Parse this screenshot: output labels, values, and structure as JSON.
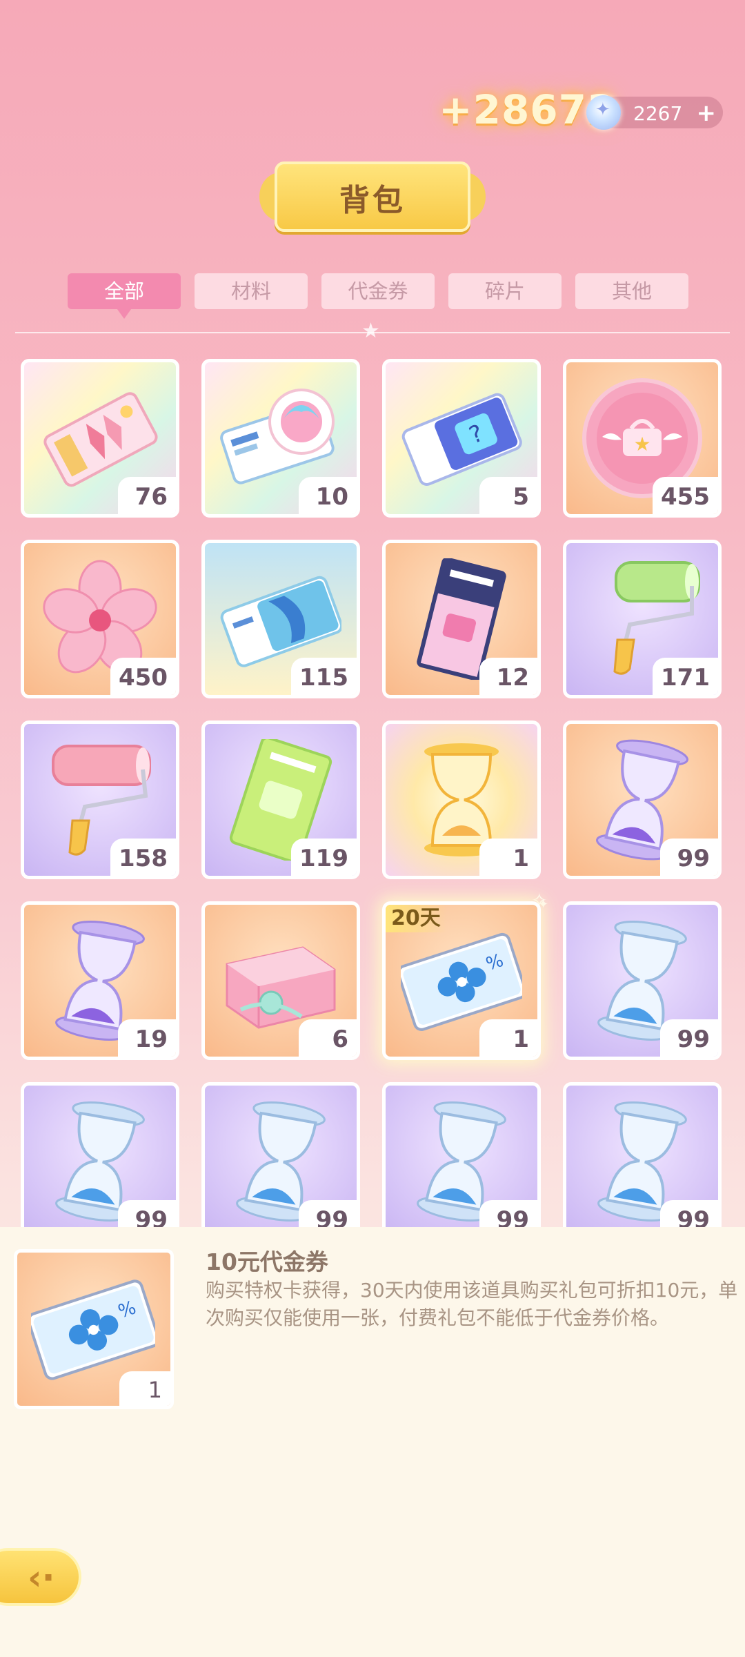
{
  "header": {
    "gain_text": "+28673",
    "currency": {
      "icon": "gem-icon",
      "amount": "2267",
      "add_label": "+"
    },
    "title": "背包"
  },
  "tabs": [
    {
      "label": "全部",
      "active": true
    },
    {
      "label": "材料",
      "active": false
    },
    {
      "label": "代金券",
      "active": false
    },
    {
      "label": "碎片",
      "active": false
    },
    {
      "label": "其他",
      "active": false
    }
  ],
  "items": [
    {
      "icon": "pink-ticket-icon",
      "count": "76",
      "bg": "rainbow"
    },
    {
      "icon": "avatar-ticket-icon",
      "count": "10",
      "bg": "rainbow"
    },
    {
      "icon": "mystery-ticket-icon",
      "count": "5",
      "bg": "rainbow"
    },
    {
      "icon": "pink-coin-icon",
      "count": "455",
      "bg": "orange"
    },
    {
      "icon": "sakura-flower-icon",
      "count": "450",
      "bg": "orange"
    },
    {
      "icon": "blue-ticket-icon",
      "count": "115",
      "bg": "blue"
    },
    {
      "icon": "sakura-ticket-icon",
      "count": "12",
      "bg": "orange"
    },
    {
      "icon": "green-roller-icon",
      "count": "171",
      "bg": "purple"
    },
    {
      "icon": "pink-roller-icon",
      "count": "158",
      "bg": "purple"
    },
    {
      "icon": "green-ticket-icon",
      "count": "119",
      "bg": "purple"
    },
    {
      "icon": "golden-hourglass-icon",
      "count": "1",
      "bg": "rainbow"
    },
    {
      "icon": "purple-hourglass-icon",
      "count": "99",
      "bg": "orange"
    },
    {
      "icon": "purple-hourglass-icon",
      "count": "19",
      "bg": "orange"
    },
    {
      "icon": "gift-box-icon",
      "count": "6",
      "bg": "orange"
    },
    {
      "icon": "sale-voucher-icon",
      "count": "1",
      "bg": "orange",
      "duration": "20天",
      "selected": true
    },
    {
      "icon": "blue-hourglass-icon",
      "count": "99",
      "bg": "purple"
    },
    {
      "icon": "blue-hourglass-icon",
      "count": "99",
      "bg": "purple"
    },
    {
      "icon": "blue-hourglass-icon",
      "count": "99",
      "bg": "purple"
    },
    {
      "icon": "blue-hourglass-icon",
      "count": "99",
      "bg": "purple"
    },
    {
      "icon": "blue-hourglass-icon",
      "count": "99",
      "bg": "purple"
    }
  ],
  "detail": {
    "icon": "sale-voucher-icon",
    "count": "1",
    "name": "10元代金券",
    "description": "购买特权卡获得，30天内使用该道具购买礼包可折扣10元，单次购买仅能使用一张，付费礼包不能低于代金券价格。"
  },
  "back_button": {
    "icon": "back-arrow-icon"
  },
  "colors": {
    "tab_active": "#f38aaf",
    "banner_gold": "#f8c946",
    "panel_bg": "#fdf7ea"
  }
}
